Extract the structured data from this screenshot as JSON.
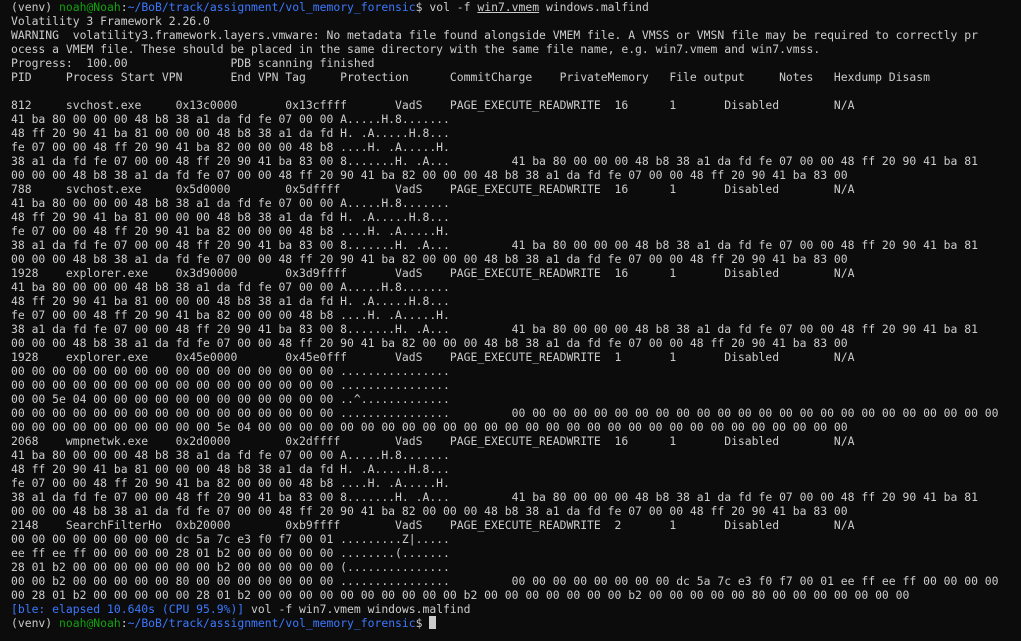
{
  "terminal": {
    "prompt": {
      "venv": "(venv) ",
      "user_host": "noah@Noah",
      "separator": ":",
      "path": "~/BoB/track/assignment/vol_memory_forensic",
      "dollar": "$ "
    },
    "command": {
      "prefix": "vol -f ",
      "file": "win7.vmem",
      "suffix": " windows.malfind"
    },
    "output_lines": [
      "Volatility 3 Framework 2.26.0",
      "WARNING  volatility3.framework.layers.vmware: No metadata file found alongside VMEM file. A VMSS or VMSN file may be required to correctly pr",
      "ocess a VMEM file. These should be placed in the same directory with the same file name, e.g. win7.vmem and win7.vmss.",
      "Progress:  100.00               PDB scanning finished",
      "PID     Process Start VPN       End VPN Tag     Protection      CommitCharge    PrivateMemory   File output     Notes   Hexdump Disasm",
      "",
      "812     svchost.exe     0x13c0000       0x13cffff       VadS    PAGE_EXECUTE_READWRITE  16      1       Disabled        N/A",
      "41 ba 80 00 00 00 48 b8 38 a1 da fd fe 07 00 00 A.....H.8.......",
      "48 ff 20 90 41 ba 81 00 00 00 48 b8 38 a1 da fd H. .A.....H.8...",
      "fe 07 00 00 48 ff 20 90 41 ba 82 00 00 00 48 b8 ....H. .A.....H.",
      "38 a1 da fd fe 07 00 00 48 ff 20 90 41 ba 83 00 8.......H. .A...         41 ba 80 00 00 00 48 b8 38 a1 da fd fe 07 00 00 48 ff 20 90 41 ba 81",
      "00 00 00 48 b8 38 a1 da fd fe 07 00 00 48 ff 20 90 41 ba 82 00 00 00 48 b8 38 a1 da fd fe 07 00 00 48 ff 20 90 41 ba 83 00",
      "788     svchost.exe     0x5d0000        0x5dffff        VadS    PAGE_EXECUTE_READWRITE  16      1       Disabled        N/A",
      "41 ba 80 00 00 00 48 b8 38 a1 da fd fe 07 00 00 A.....H.8.......",
      "48 ff 20 90 41 ba 81 00 00 00 48 b8 38 a1 da fd H. .A.....H.8...",
      "fe 07 00 00 48 ff 20 90 41 ba 82 00 00 00 48 b8 ....H. .A.....H.",
      "38 a1 da fd fe 07 00 00 48 ff 20 90 41 ba 83 00 8.......H. .A...         41 ba 80 00 00 00 48 b8 38 a1 da fd fe 07 00 00 48 ff 20 90 41 ba 81",
      "00 00 00 48 b8 38 a1 da fd fe 07 00 00 48 ff 20 90 41 ba 82 00 00 00 48 b8 38 a1 da fd fe 07 00 00 48 ff 20 90 41 ba 83 00",
      "1928    explorer.exe    0x3d90000       0x3d9ffff       VadS    PAGE_EXECUTE_READWRITE  16      1       Disabled        N/A",
      "41 ba 80 00 00 00 48 b8 38 a1 da fd fe 07 00 00 A.....H.8.......",
      "48 ff 20 90 41 ba 81 00 00 00 48 b8 38 a1 da fd H. .A.....H.8...",
      "fe 07 00 00 48 ff 20 90 41 ba 82 00 00 00 48 b8 ....H. .A.....H.",
      "38 a1 da fd fe 07 00 00 48 ff 20 90 41 ba 83 00 8.......H. .A...         41 ba 80 00 00 00 48 b8 38 a1 da fd fe 07 00 00 48 ff 20 90 41 ba 81",
      "00 00 00 48 b8 38 a1 da fd fe 07 00 00 48 ff 20 90 41 ba 82 00 00 00 48 b8 38 a1 da fd fe 07 00 00 48 ff 20 90 41 ba 83 00",
      "1928    explorer.exe    0x45e0000       0x45e0fff       VadS    PAGE_EXECUTE_READWRITE  1       1       Disabled        N/A",
      "00 00 00 00 00 00 00 00 00 00 00 00 00 00 00 00 ................",
      "00 00 00 00 00 00 00 00 00 00 00 00 00 00 00 00 ................",
      "00 00 5e 04 00 00 00 00 00 00 00 00 00 00 00 00 ..^.............",
      "00 00 00 00 00 00 00 00 00 00 00 00 00 00 00 00 ................         00 00 00 00 00 00 00 00 00 00 00 00 00 00 00 00 00 00 00 00 00 00 00 00",
      "00 00 00 00 00 00 00 00 00 00 5e 04 00 00 00 00 00 00 00 00 00 00 00 00 00 00 00 00 00 00 00 00 00 00 00 00 00 00 00 00 00",
      "2068    wmpnetwk.exe    0x2d0000        0x2dffff        VadS    PAGE_EXECUTE_READWRITE  16      1       Disabled        N/A",
      "41 ba 80 00 00 00 48 b8 38 a1 da fd fe 07 00 00 A.....H.8.......",
      "48 ff 20 90 41 ba 81 00 00 00 48 b8 38 a1 da fd H. .A.....H.8...",
      "fe 07 00 00 48 ff 20 90 41 ba 82 00 00 00 48 b8 ....H. .A.....H.",
      "38 a1 da fd fe 07 00 00 48 ff 20 90 41 ba 83 00 8.......H. .A...         41 ba 80 00 00 00 48 b8 38 a1 da fd fe 07 00 00 48 ff 20 90 41 ba 81",
      "00 00 00 48 b8 38 a1 da fd fe 07 00 00 48 ff 20 90 41 ba 82 00 00 00 48 b8 38 a1 da fd fe 07 00 00 48 ff 20 90 41 ba 83 00",
      "2148    SearchFilterHo  0xb20000        0xb9ffff        VadS    PAGE_EXECUTE_READWRITE  2       1       Disabled        N/A",
      "00 00 00 00 00 00 00 00 dc 5a 7c e3 f0 f7 00 01 .........Z|.....",
      "ee ff ee ff 00 00 00 00 28 01 b2 00 00 00 00 00 ........(.......",
      "28 01 b2 00 00 00 00 00 00 00 b2 00 00 00 00 00 (...............",
      "00 00 b2 00 00 00 00 00 80 00 00 00 00 00 00 00 ................         00 00 00 00 00 00 00 00 dc 5a 7c e3 f0 f7 00 01 ee ff ee ff 00 00 00 00",
      "00 28 01 b2 00 00 00 00 00 28 01 b2 00 00 00 00 00 00 00 00 00 00 b2 00 00 00 00 00 00 00 b2 00 00 00 00 00 80 00 00 00 00 00 00 00"
    ],
    "ble_status": "[ble: elapsed 10.640s (CPU 95.9%)]",
    "ble_command": " vol -f win7.vmem windows.malfind",
    "colors": {
      "background": "#0c0c0c",
      "text": "#cccccc",
      "prompt_user": "#13a10e",
      "prompt_path": "#3b78ff"
    }
  }
}
